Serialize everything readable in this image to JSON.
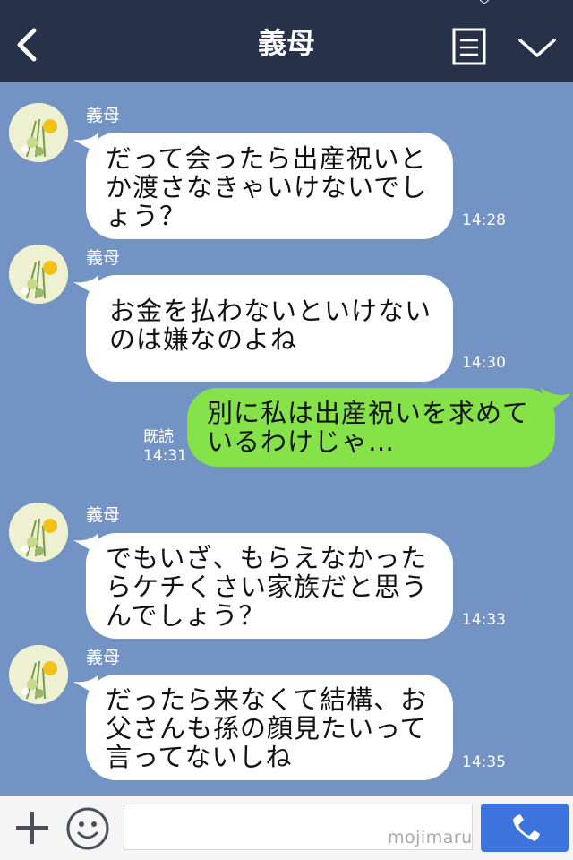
{
  "header": {
    "title": "義母"
  },
  "messages": [
    {
      "sender": "義母",
      "text": "だって会ったら出産祝いと\nか渡さなきゃいけないでし\nょう？",
      "time": "14:28"
    },
    {
      "sender": "義母",
      "text": "お金を払わないといけない\nのは嫌なのよね",
      "time": "14:30"
    },
    {
      "text": "別に私は出産祝いを求めて\nいるわけじゃ…",
      "read": "既読",
      "time": "14:31"
    },
    {
      "sender": "義母",
      "text": "でもいざ、もらえなかった\nらケチくさい家族だと思う\nんでしょう？",
      "time": "14:33"
    },
    {
      "sender": "義母",
      "text": "だったら来なくて結構、お\n父さんも孫の顔見たいって\n言ってないしね",
      "time": "14:35"
    }
  ],
  "input": {
    "watermark": "mojimaru"
  },
  "icons": {
    "back": "chevron-left-icon",
    "menu": "note-list-icon",
    "collapse": "chevron-down-icon",
    "plus": "plus-icon",
    "emoji": "smiley-icon",
    "call": "phone-icon"
  },
  "colors": {
    "header": "#27324a",
    "background": "#7393c4",
    "incoming_bubble": "#ffffff",
    "outgoing_bubble": "#85e249",
    "call_button": "#3d73dd"
  }
}
